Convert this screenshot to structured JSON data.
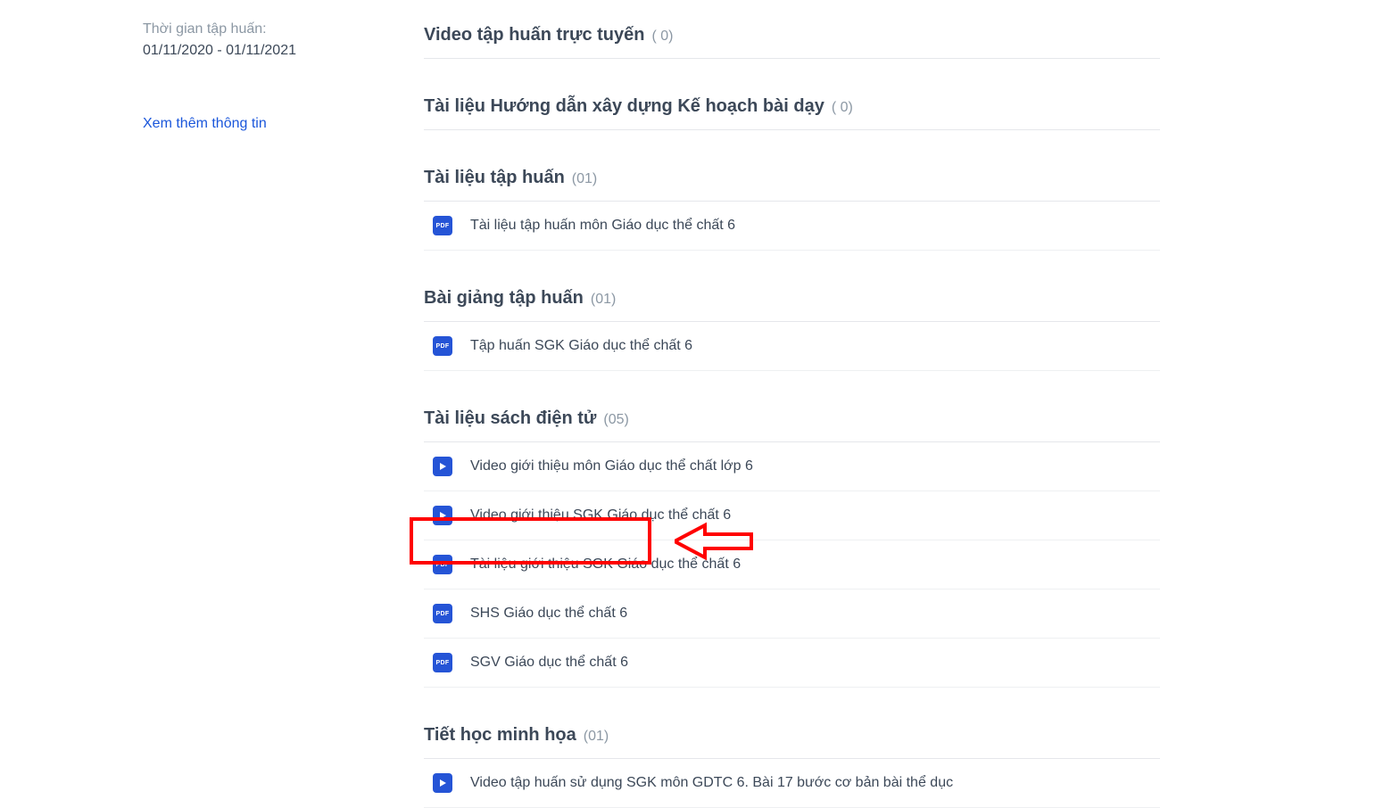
{
  "sidebar": {
    "time_label": "Thời gian tập huấn:",
    "time_value": "01/11/2020 - 01/11/2021",
    "more_link": "Xem thêm thông tin"
  },
  "sections": [
    {
      "title": "Video tập huấn trực tuyến",
      "count": "( 0)",
      "items": []
    },
    {
      "title": "Tài liệu Hướng dẫn xây dựng Kế hoạch bài dạy",
      "count": "( 0)",
      "items": []
    },
    {
      "title": "Tài liệu tập huấn",
      "count": "(01)",
      "items": [
        {
          "icon": "pdf",
          "label": "Tài liệu tập huấn môn Giáo dục thể chất 6"
        }
      ]
    },
    {
      "title": "Bài giảng tập huấn",
      "count": "(01)",
      "items": [
        {
          "icon": "pdf",
          "label": "Tập huấn SGK Giáo dục thể chất 6"
        }
      ]
    },
    {
      "title": "Tài liệu sách điện tử",
      "count": "(05)",
      "items": [
        {
          "icon": "video",
          "label": "Video giới thiệu môn Giáo dục thể chất lớp 6"
        },
        {
          "icon": "video",
          "label": "Video giới thiệu SGK Giáo dục thể chất 6"
        },
        {
          "icon": "pdf",
          "label": "Tài liệu giới thiệu SGK Giáo dục thể chất 6"
        },
        {
          "icon": "pdf",
          "label": "SHS Giáo dục thể chất 6"
        },
        {
          "icon": "pdf",
          "label": "SGV Giáo dục thể chất 6"
        }
      ]
    },
    {
      "title": "Tiết học minh họa",
      "count": "(01)",
      "items": [
        {
          "icon": "video",
          "label": "Video tập huấn sử dụng SGK môn GDTC 6. Bài 17 bước cơ bản bài thể dục"
        }
      ]
    }
  ],
  "annotation": {
    "highlight_section_index": 4,
    "highlight_item_index": 3
  }
}
